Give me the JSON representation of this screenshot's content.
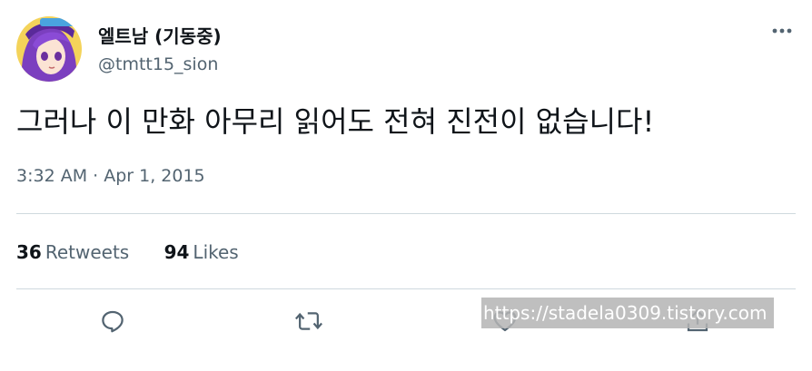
{
  "author": {
    "display_name": "엘트남 (기동중)",
    "handle": "@tmtt15_sion"
  },
  "tweet": {
    "text": "그러나 이 만화 아무리 읽어도 전혀 진전이 없습니다!",
    "timestamp": "3:32 AM · Apr 1, 2015"
  },
  "stats": {
    "retweets_count": "36",
    "retweets_label": "Retweets",
    "likes_count": "94",
    "likes_label": "Likes"
  },
  "watermark": {
    "text": "https://stadela0309.tistory.com"
  },
  "icons": {
    "more": "more-icon",
    "reply": "reply-icon",
    "retweet": "retweet-icon",
    "like": "heart-icon",
    "share": "share-icon"
  },
  "colors": {
    "primary_text": "#0f1419",
    "secondary_text": "#536471",
    "divider": "#cfd9de"
  }
}
